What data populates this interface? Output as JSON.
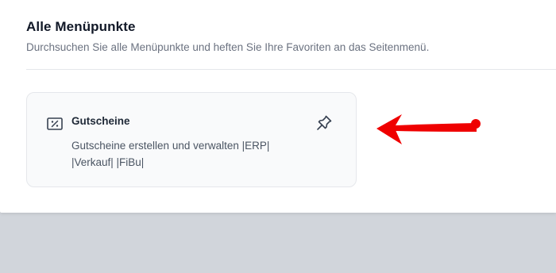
{
  "header": {
    "title": "Alle Menüpunkte",
    "subtitle": "Durchsuchen Sie alle Menüpunkte und heften Sie Ihre Favoriten an das Seitenmenü."
  },
  "card": {
    "title": "Gutscheine",
    "description_line1": "Gutscheine erstellen und verwalten |ERP|",
    "description_line2": "|Verkauf| |FiBu|",
    "icon": "voucher-percent-icon",
    "pin_icon": "pin-icon"
  },
  "annotation": {
    "arrow_color": "#ef0000"
  }
}
